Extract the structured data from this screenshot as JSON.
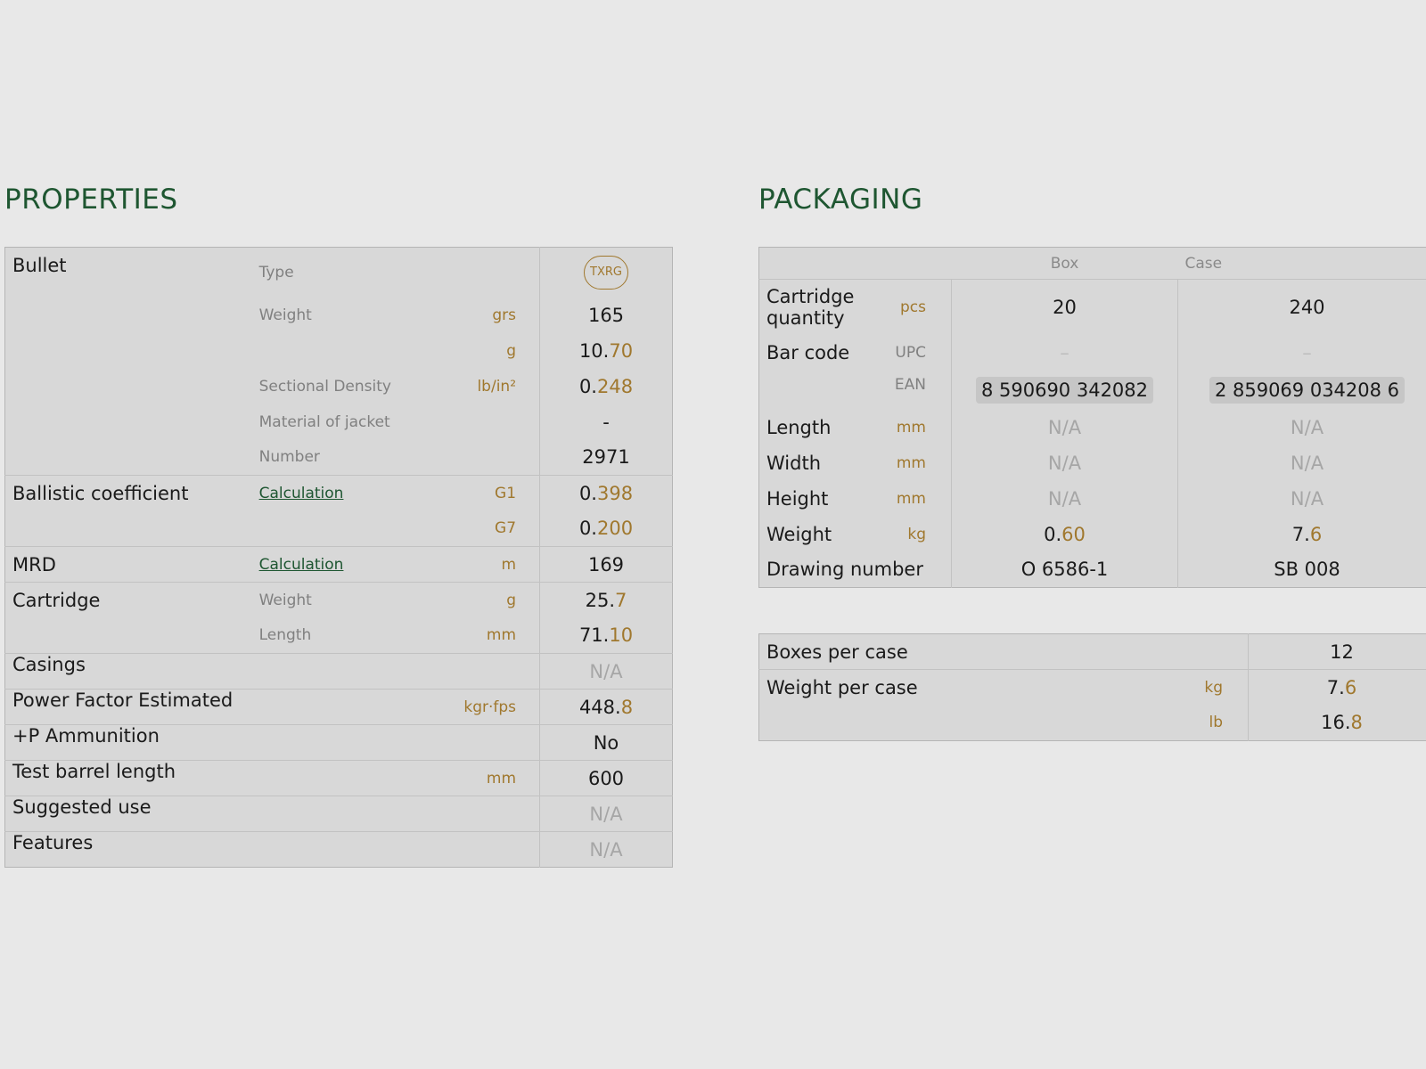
{
  "properties": {
    "title": "PROPERTIES",
    "bullet": {
      "label": "Bullet",
      "type_label": "Type",
      "type_badge": "TXRG",
      "weight_label": "Weight",
      "weight_grs_unit": "grs",
      "weight_grs_int": "165",
      "weight_g_unit": "g",
      "weight_g_int": "10.",
      "weight_g_dec": "70",
      "sd_label": "Sectional Density",
      "sd_unit": "lb/in²",
      "sd_int": "0.",
      "sd_dec": "248",
      "jacket_label": "Material of jacket",
      "jacket_value": "-",
      "number_label": "Number",
      "number_value": "2971"
    },
    "ballistic": {
      "label": "Ballistic coefficient",
      "link": "Calculation",
      "g1_unit": "G1",
      "g1_int": "0.",
      "g1_dec": "398",
      "g7_unit": "G7",
      "g7_int": "0.",
      "g7_dec": "200"
    },
    "mrd": {
      "label": "MRD",
      "link": "Calculation",
      "unit": "m",
      "value": "169"
    },
    "cartridge": {
      "label": "Cartridge",
      "weight_label": "Weight",
      "weight_unit": "g",
      "weight_int": "25.",
      "weight_dec": "7",
      "length_label": "Length",
      "length_unit": "mm",
      "length_int": "71.",
      "length_dec": "10"
    },
    "casings": {
      "label": "Casings",
      "value": "N/A"
    },
    "power_factor": {
      "label": "Power Factor Estimated",
      "unit": "kgr·fps",
      "int": "448.",
      "dec": "8"
    },
    "plus_p": {
      "label": "+P Ammunition",
      "value": "No"
    },
    "barrel": {
      "label": "Test barrel length",
      "unit": "mm",
      "value": "600"
    },
    "suggested_use": {
      "label": "Suggested use",
      "value": "N/A"
    },
    "features": {
      "label": "Features",
      "value": "N/A"
    }
  },
  "packaging": {
    "title": "PACKAGING",
    "col_box": "Box",
    "col_case": "Case",
    "quantity": {
      "label": "Cartridge quantity",
      "unit": "pcs",
      "box": "20",
      "case": "240"
    },
    "barcode": {
      "label": "Bar code",
      "upc_unit": "UPC",
      "upc_box": "–",
      "upc_case": "–",
      "ean_unit": "EAN",
      "ean_box": "8 590690 342082",
      "ean_case": "2 859069 034208 6"
    },
    "length": {
      "label": "Length",
      "unit": "mm",
      "box": "N/A",
      "case": "N/A"
    },
    "width": {
      "label": "Width",
      "unit": "mm",
      "box": "N/A",
      "case": "N/A"
    },
    "height": {
      "label": "Height",
      "unit": "mm",
      "box": "N/A",
      "case": "N/A"
    },
    "weight": {
      "label": "Weight",
      "unit": "kg",
      "box_int": "0.",
      "box_dec": "60",
      "case_int": "7.",
      "case_dec": "6"
    },
    "drawing": {
      "label": "Drawing number",
      "box": "O 6586-1",
      "case": "SB 008"
    }
  },
  "case_info": {
    "boxes_per_case": {
      "label": "Boxes per case",
      "value": "12"
    },
    "weight_per_case": {
      "label": "Weight per case",
      "kg_unit": "kg",
      "kg_int": "7.",
      "kg_dec": "6",
      "lb_unit": "lb",
      "lb_int": "16.",
      "lb_dec": "8"
    }
  }
}
